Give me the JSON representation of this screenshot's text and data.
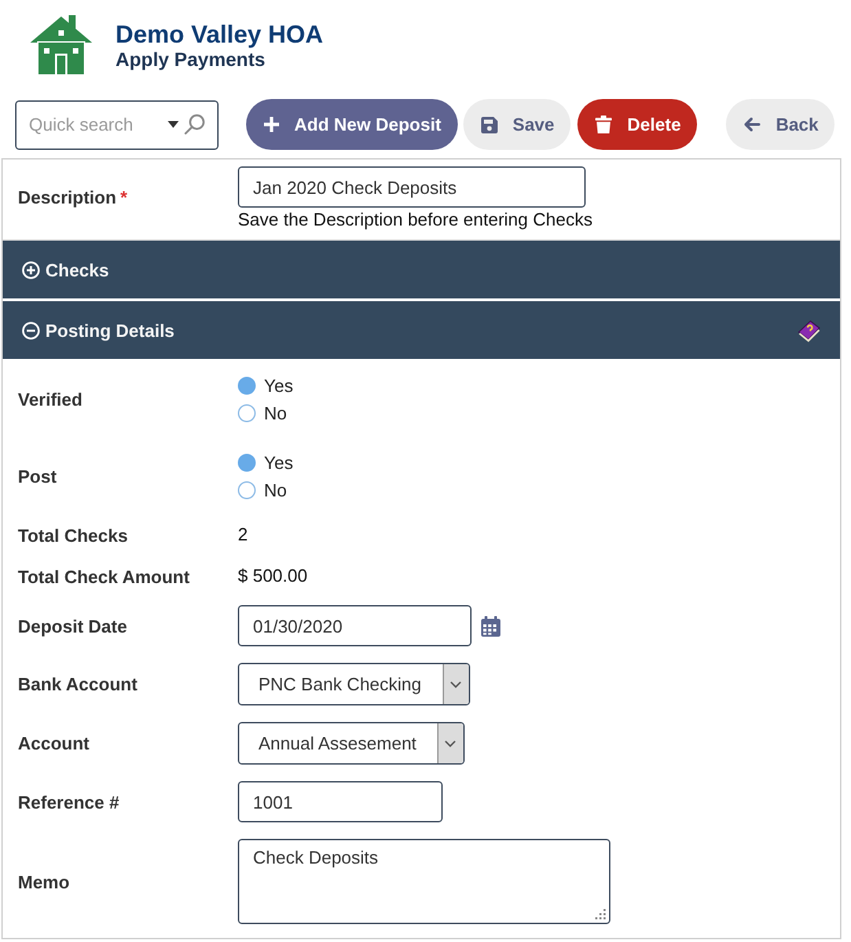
{
  "header": {
    "title": "Demo Valley HOA",
    "subtitle": "Apply Payments"
  },
  "toolbar": {
    "search": {
      "placeholder": "Quick search"
    },
    "buttons": [
      {
        "kind": "add",
        "label": "Add New Deposit"
      },
      {
        "kind": "save",
        "label": "Save"
      },
      {
        "kind": "delete",
        "label": "Delete"
      },
      {
        "kind": "back",
        "label": "Back"
      }
    ]
  },
  "description": {
    "label": "Description",
    "required_mark": "*",
    "value": "Jan 2020 Check Deposits",
    "hint": "Save the Description before entering Checks"
  },
  "sections": [
    {
      "title": "Checks",
      "expanded": false,
      "help": false
    },
    {
      "title": "Posting Details",
      "expanded": true,
      "help": true,
      "fields": [
        {
          "kind": "radio",
          "label": "Verified",
          "options": [
            {
              "label": "Yes",
              "selected": true
            },
            {
              "label": "No",
              "selected": false
            }
          ]
        },
        {
          "kind": "radio",
          "label": "Post",
          "options": [
            {
              "label": "Yes",
              "selected": true
            },
            {
              "label": "No",
              "selected": false
            }
          ]
        },
        {
          "kind": "static",
          "label": "Total Checks",
          "value": "2"
        },
        {
          "kind": "static",
          "label": "Total Check Amount",
          "value": "$ 500.00"
        },
        {
          "kind": "date",
          "label": "Deposit Date",
          "value": "01/30/2020"
        },
        {
          "kind": "select",
          "label": "Bank Account",
          "value": "PNC Bank Checking"
        },
        {
          "kind": "select",
          "label": "Account",
          "value": "Annual Assesement"
        },
        {
          "kind": "input",
          "label": "Reference #",
          "value": "1001"
        },
        {
          "kind": "textarea",
          "label": "Memo",
          "value": "Check Deposits"
        }
      ]
    }
  ]
}
